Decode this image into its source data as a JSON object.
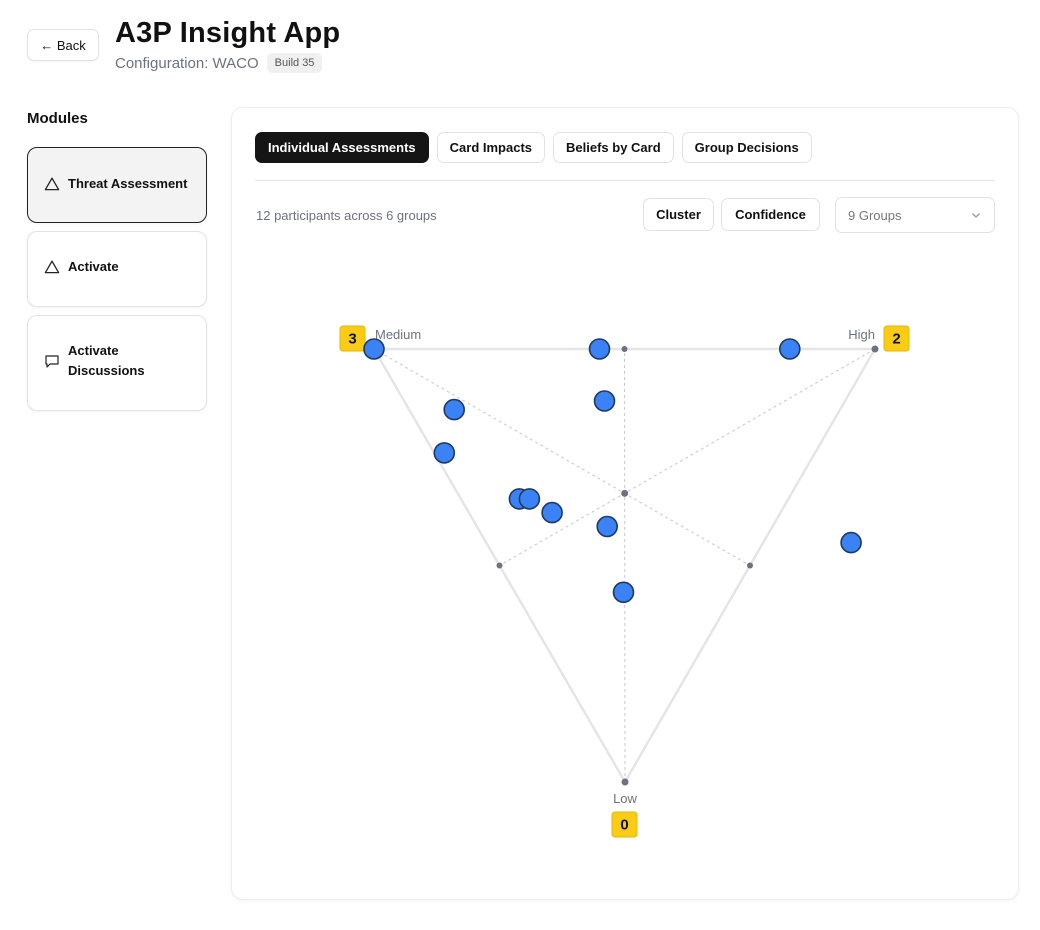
{
  "header": {
    "back_label": "← Back",
    "title": "A3P Insight App",
    "config": "Configuration: WACO",
    "build": "Build 35"
  },
  "sidebar": {
    "heading": "Modules",
    "items": [
      {
        "label": "Threat Assessment",
        "icon": "triangle-icon",
        "active": true
      },
      {
        "label": "Activate",
        "icon": "triangle-icon",
        "active": false
      },
      {
        "label": "Activate Discussions",
        "icon": "chat-bubble-icon",
        "active": false
      }
    ]
  },
  "tabs": [
    {
      "label": "Individual Assessments",
      "active": true
    },
    {
      "label": "Card Impacts",
      "active": false
    },
    {
      "label": "Beliefs by Card",
      "active": false
    },
    {
      "label": "Group Decisions",
      "active": false
    }
  ],
  "toolbar": {
    "participants_text": "12 participants across 6 groups",
    "cluster_label": "Cluster",
    "confidence_label": "Confidence",
    "groups_select": "9 Groups"
  },
  "chart_data": {
    "type": "scatter",
    "vertices": [
      {
        "label": "Medium",
        "count": "3"
      },
      {
        "label": "High",
        "count": "2"
      },
      {
        "label": "Low",
        "count": "0"
      }
    ],
    "coordinates": "barycentric weights [medium, high, low]",
    "points": [
      [
        1.0,
        0.0,
        0.0
      ],
      [
        0.55,
        0.45,
        0.0
      ],
      [
        0.17,
        0.83,
        0.0
      ],
      [
        0.77,
        0.09,
        0.14
      ],
      [
        0.48,
        0.4,
        0.12
      ],
      [
        0.19,
        0.67,
        0.31
      ],
      [
        0.74,
        0.02,
        0.24
      ],
      [
        0.58,
        0.11,
        0.33
      ],
      [
        0.56,
        0.13,
        0.33
      ],
      [
        0.37,
        0.18,
        0.41
      ],
      [
        0.33,
        0.26,
        0.41
      ],
      [
        0.2,
        0.22,
        0.57
      ]
    ],
    "colors": {
      "point": "#3b82f6",
      "point_stroke": "#1e3a5f",
      "badge": "#facc15",
      "edge": "#e5e5e5"
    }
  }
}
